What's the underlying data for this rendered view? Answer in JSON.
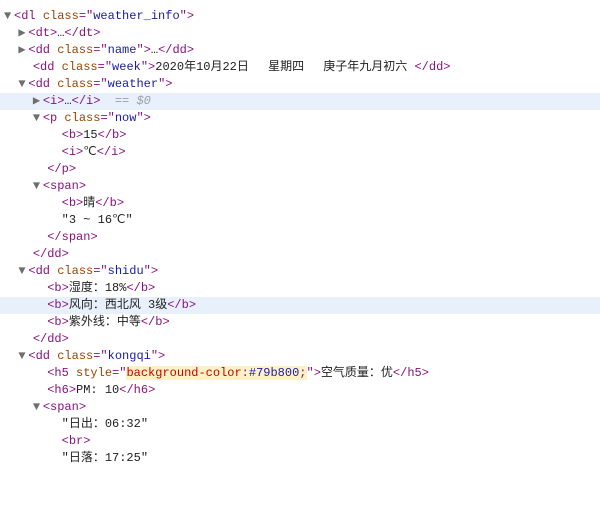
{
  "arrows": {
    "right": "▶",
    "down": "▼"
  },
  "eq0": "== $0",
  "ellipsis": "…",
  "tags": {
    "dl": "dl",
    "dt": "dt",
    "dd": "dd",
    "i": "i",
    "p": "p",
    "b": "b",
    "span": "span",
    "h5": "h5",
    "h6": "h6",
    "br": "br"
  },
  "classes": {
    "weather_info": "weather_info",
    "name": "name",
    "week": "week",
    "weather": "weather",
    "now": "now",
    "shidu": "shidu",
    "kongqi": "kongqi"
  },
  "style_attr": "style",
  "class_attr": "class",
  "kongqi_style": {
    "prop": "background-color",
    "val": "#79b800"
  },
  "week_text": "2020年10月22日　 星期四　 庚子年九月初六 ",
  "now_temp": "15",
  "now_unit": "℃",
  "weather_desc": "晴",
  "weather_range": "3 ~ 16℃",
  "shidu": {
    "humidity": "湿度：18%",
    "wind": "风向：西北风 3级",
    "uv": "紫外线：中等"
  },
  "kongqi": {
    "aq": "空气质量：优",
    "pm": "PM: 10",
    "sunrise": "日出：06:32",
    "sunset": "日落：17:25"
  }
}
